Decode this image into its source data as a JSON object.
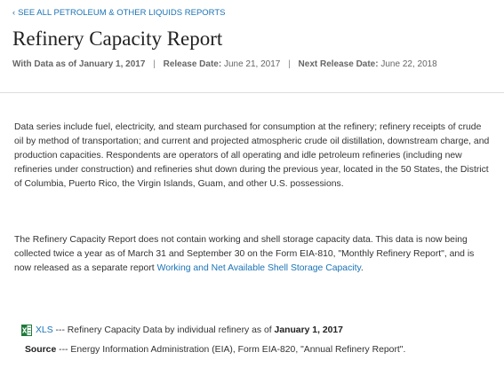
{
  "breadcrumb": {
    "chevron": "‹",
    "label": "SEE ALL PETROLEUM & OTHER LIQUIDS REPORTS"
  },
  "page": {
    "title": "Refinery Capacity Report"
  },
  "meta": {
    "data_as_of_label": "With Data as of January 1, 2017",
    "separator": "|",
    "release_label": "Release Date:",
    "release_value": "June 21, 2017",
    "next_release_label": "Next Release Date:",
    "next_release_value": "June 22, 2018"
  },
  "body": {
    "paragraph1": "Data series include fuel, electricity, and steam purchased for consumption at the refinery; refinery receipts of crude oil by method of transportation; and current and projected atmospheric crude oil distillation, downstream charge, and production capacities. Respondents are operators of all operating and idle petroleum refineries (including new refineries under construction) and refineries shut down during the previous year, located in the 50 States, the District of Columbia, Puerto Rico, the Virgin Islands, Guam, and other U.S. possessions.",
    "paragraph2_text": "The Refinery Capacity Report does not contain working and shell storage capacity data. This data is now being collected twice a year as of March 31 and September 30 on the Form EIA-810, \"Monthly Refinery Report\", and is now released as a separate report ",
    "paragraph2_link": "Working and Net Available Shell Storage Capacity",
    "paragraph2_end": "."
  },
  "downloads": {
    "xls_icon": "excel-file-icon",
    "xls_link": "XLS",
    "xls_desc": " --- Refinery Capacity Data by individual refinery as of ",
    "xls_date": "January 1, 2017",
    "source_label": "Source",
    "source_text": " --- Energy Information Administration (EIA), Form EIA-820, \"Annual Refinery Report\"."
  },
  "colors": {
    "link": "#1a73b5",
    "text": "#333333",
    "meta": "#666666",
    "xls_green": "#1d7a3a"
  }
}
